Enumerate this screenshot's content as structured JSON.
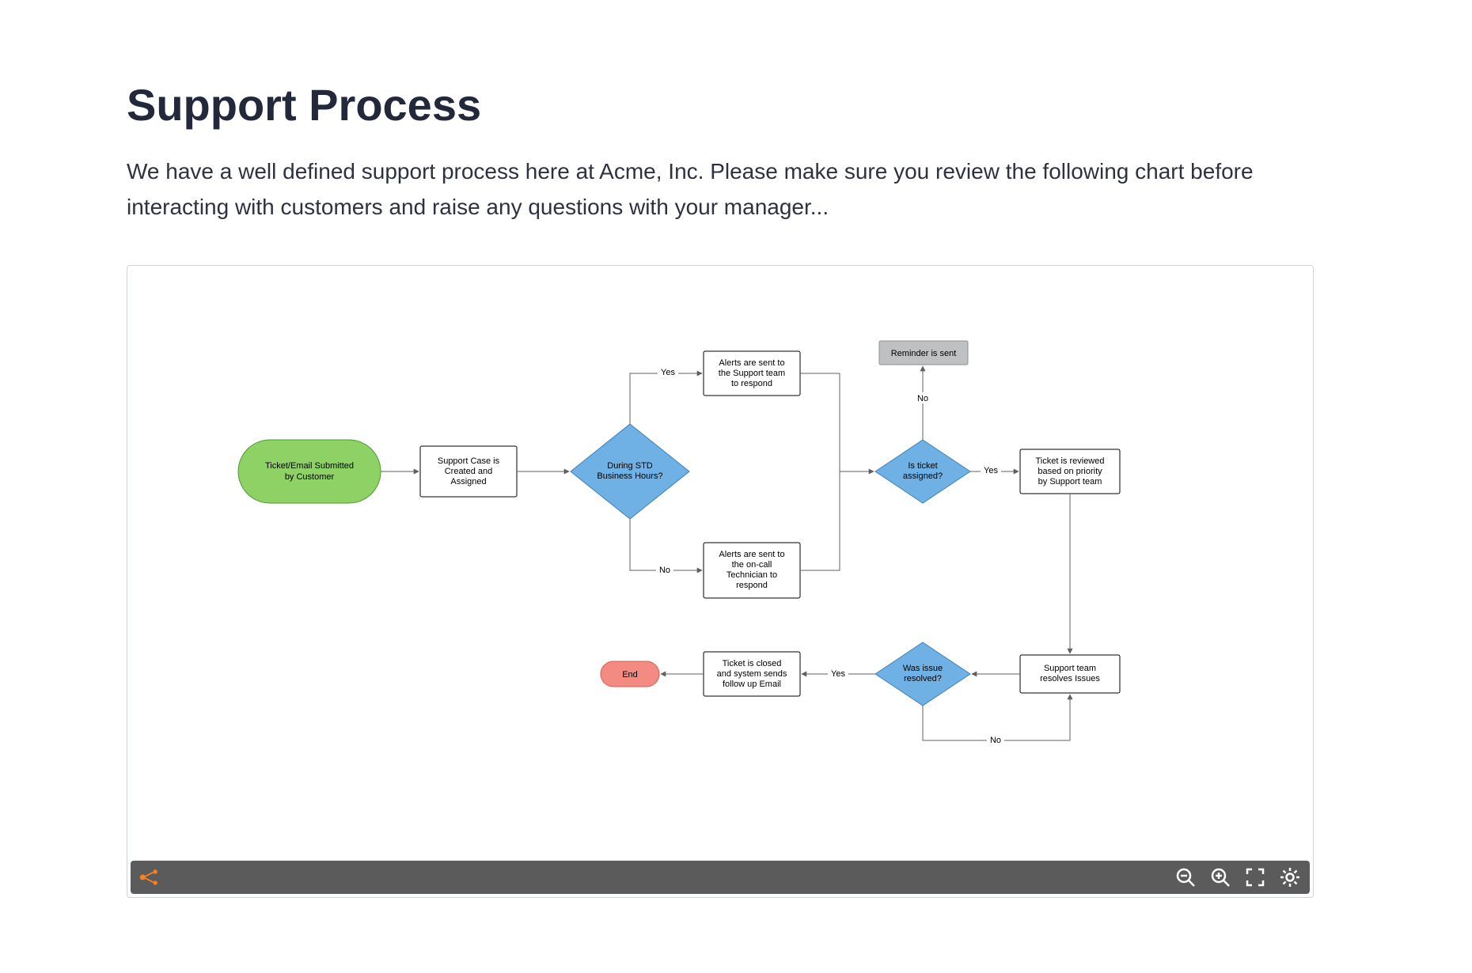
{
  "title": "Support Process",
  "intro": "We have a well defined support process here at Acme, Inc. Please make sure you review the following chart before interacting with customers and raise any questions with your manager...",
  "edges": {
    "yes1": "Yes",
    "no1": "No",
    "yes2": "Yes",
    "no2": "No",
    "yes3": "Yes",
    "no3": "No"
  },
  "nodes": {
    "start": [
      "Ticket/Email Submitted",
      "by Customer"
    ],
    "case_created": [
      "Support Case is",
      "Created and",
      "Assigned"
    ],
    "std_hours": [
      "During STD",
      "Business Hours?"
    ],
    "alerts_support": [
      "Alerts are sent to",
      "the Support team",
      "to respond"
    ],
    "alerts_oncall": [
      "Alerts are sent to",
      "the on-call",
      "Technician to",
      "respond"
    ],
    "is_assigned": [
      "Is ticket",
      "assigned?"
    ],
    "reminder": [
      "Reminder is sent"
    ],
    "reviewed": [
      "Ticket is reviewed",
      "based on priority",
      "by Support team"
    ],
    "resolves": [
      "Support team",
      "resolves Issues"
    ],
    "was_resolved": [
      "Was issue",
      "resolved?"
    ],
    "closed": [
      "Ticket is closed",
      "and system sends",
      "follow up Email"
    ],
    "end": [
      "End"
    ]
  }
}
